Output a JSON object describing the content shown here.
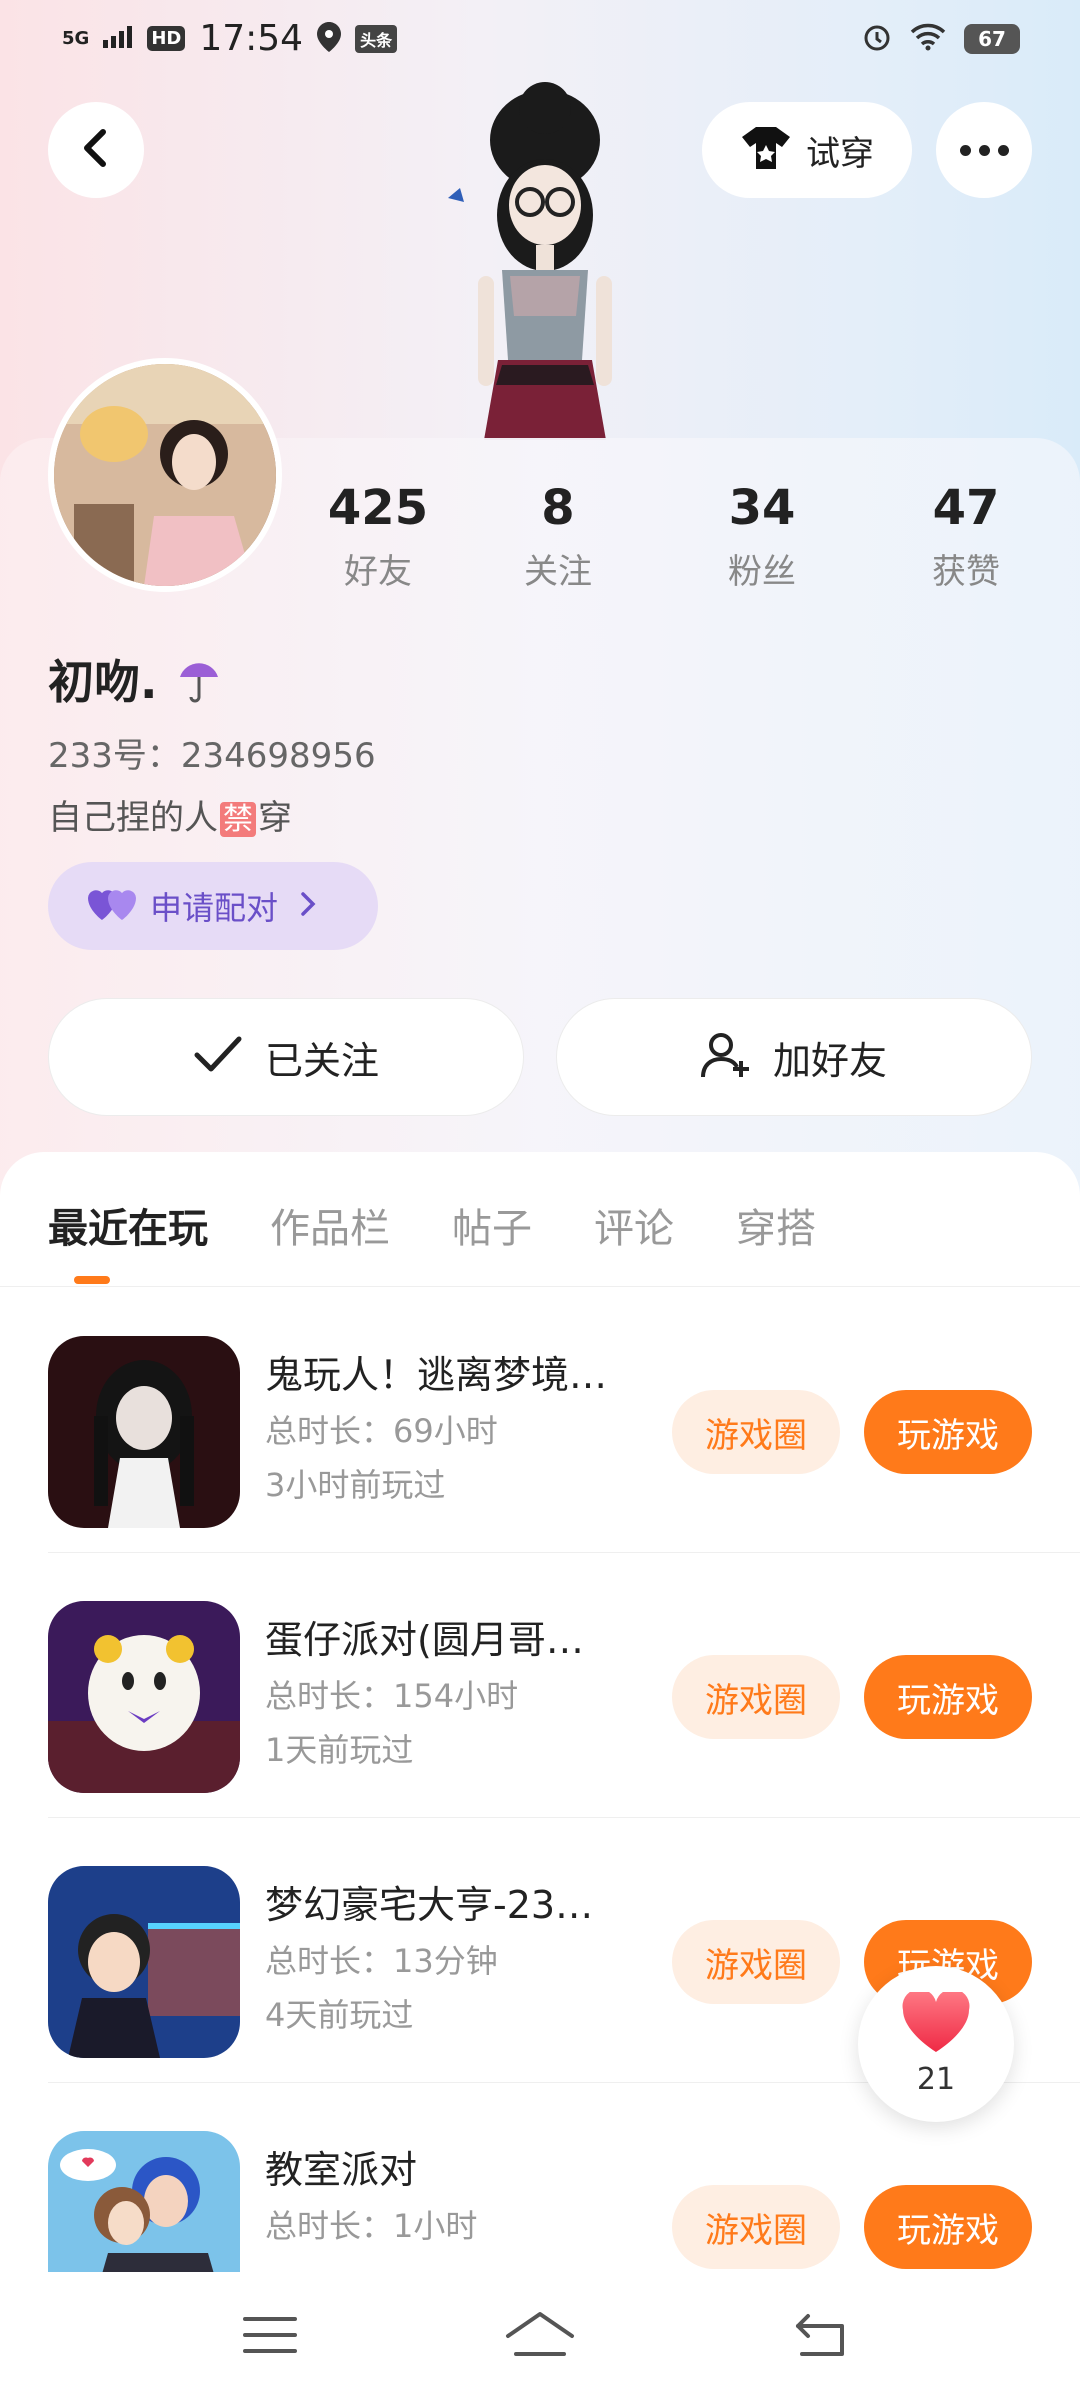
{
  "status_bar": {
    "network": "5G",
    "hd": "HD",
    "time": "17:54",
    "toutiao": "头条",
    "battery": "67"
  },
  "header": {
    "tryon_label": "试穿"
  },
  "profile": {
    "stats": [
      {
        "value": "425",
        "label": "好友"
      },
      {
        "value": "8",
        "label": "关注"
      },
      {
        "value": "34",
        "label": "粉丝"
      },
      {
        "value": "47",
        "label": "获赞"
      }
    ],
    "nickname": "初吻.",
    "id_line": "233号：234698956",
    "bio_before": "自己捏的人",
    "bio_badge": "禁",
    "bio_after": "穿",
    "pair_label": "申请配对",
    "follow_label": "已关注",
    "add_friend_label": "加好友"
  },
  "tabs": [
    {
      "label": "最近在玩",
      "active": true
    },
    {
      "label": "作品栏",
      "active": false
    },
    {
      "label": "帖子",
      "active": false
    },
    {
      "label": "评论",
      "active": false
    },
    {
      "label": "穿搭",
      "active": false
    }
  ],
  "games": [
    {
      "title": "鬼玩人！逃离梦境…",
      "duration": "总时长：69小时",
      "last_played": "3小时前玩过",
      "circle_label": "游戏圈",
      "play_label": "玩游戏"
    },
    {
      "title": "蛋仔派对(圆月哥…",
      "duration": "总时长：154小时",
      "last_played": "1天前玩过",
      "circle_label": "游戏圈",
      "play_label": "玩游戏"
    },
    {
      "title": "梦幻豪宅大亨-23…",
      "duration": "总时长：13分钟",
      "last_played": "4天前玩过",
      "circle_label": "游戏圈",
      "play_label": "玩游戏"
    },
    {
      "title": "教室派对",
      "duration": "总时长：1小时",
      "last_played": "",
      "circle_label": "游戏圈",
      "play_label": "玩游戏"
    }
  ],
  "like_fab": {
    "count": "21"
  },
  "colors": {
    "accent": "#ff7a1a",
    "accent_light": "#feeee2",
    "pair_purple": "#6a4fc8"
  }
}
